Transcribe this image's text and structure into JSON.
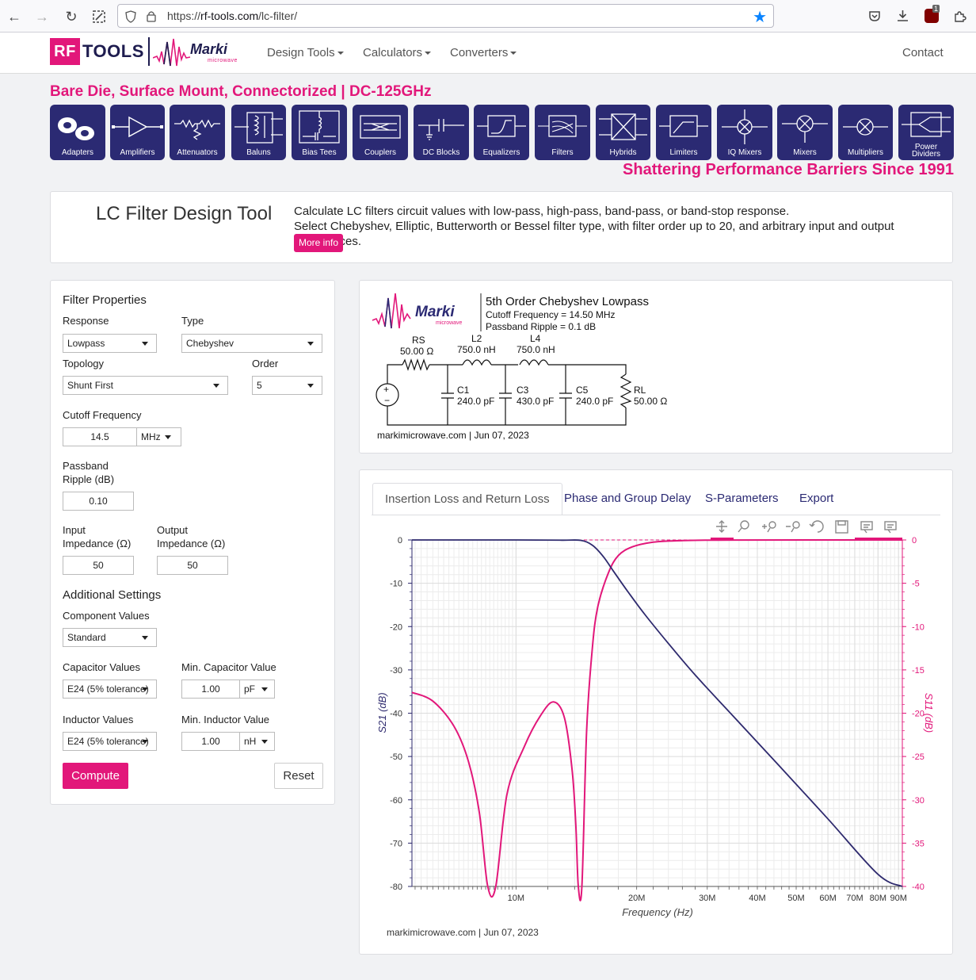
{
  "browser": {
    "url_prefix": "https://",
    "url_host": "rf-tools.com",
    "url_path": "/lc-filter/",
    "ext_badge": "1"
  },
  "header": {
    "logo_rf": "RF",
    "logo_tools": "TOOLS",
    "brand": "Marki",
    "brand_sub": "microwave",
    "menu": [
      "Design Tools",
      "Calculators",
      "Converters"
    ],
    "contact": "Contact"
  },
  "banner": {
    "title": "Bare Die, Surface Mount, Connectorized | DC-125GHz",
    "tagline": "Shattering Performance Barriers Since 1991",
    "products": [
      {
        "label": "Adapters",
        "icon": "adapter-icon"
      },
      {
        "label": "Amplifiers",
        "icon": "amplifier-icon"
      },
      {
        "label": "Attenuators",
        "icon": "attenuator-icon"
      },
      {
        "label": "Baluns",
        "icon": "balun-icon"
      },
      {
        "label": "Bias Tees",
        "icon": "bias-tee-icon"
      },
      {
        "label": "Couplers",
        "icon": "coupler-icon"
      },
      {
        "label": "DC Blocks",
        "icon": "dc-block-icon"
      },
      {
        "label": "Equalizers",
        "icon": "equalizer-icon"
      },
      {
        "label": "Filters",
        "icon": "filter-icon"
      },
      {
        "label": "Hybrids",
        "icon": "hybrid-icon"
      },
      {
        "label": "Limiters",
        "icon": "limiter-icon"
      },
      {
        "label": "IQ Mixers",
        "icon": "iq-mixer-icon"
      },
      {
        "label": "Mixers",
        "icon": "mixer-icon"
      },
      {
        "label": "Multipliers",
        "icon": "multiplier-icon"
      },
      {
        "label": "Power Dividers",
        "icon": "power-divider-icon"
      }
    ]
  },
  "intro": {
    "title": "LC Filter Design Tool",
    "line1": "Calculate LC filters circuit values with low-pass, high-pass, band-pass, or band-stop response.",
    "line2": "Select Chebyshev, Elliptic, Butterworth or Bessel filter type, with filter order up to 20, and arbitrary input and output impedances.",
    "more_info": "More info"
  },
  "form": {
    "section_filter": "Filter Properties",
    "response_label": "Response",
    "response_value": "Lowpass",
    "type_label": "Type",
    "type_value": "Chebyshev",
    "topology_label": "Topology",
    "topology_value": "Shunt First",
    "order_label": "Order",
    "order_value": "5",
    "cutoff_label": "Cutoff Frequency",
    "cutoff_value": "14.5",
    "cutoff_unit": "MHz",
    "ripple_label_1": "Passband",
    "ripple_label_2": "Ripple (dB)",
    "ripple_value": "0.10",
    "input_imp_label_1": "Input",
    "input_imp_label_2": "Impedance (Ω)",
    "input_imp_value": "50",
    "output_imp_label_1": "Output",
    "output_imp_label_2": "Impedance (Ω)",
    "output_imp_value": "50",
    "section_additional": "Additional Settings",
    "component_values_label": "Component Values",
    "component_values_value": "Standard",
    "cap_values_label": "Capacitor Values",
    "cap_values_value": "E24 (5% tolerance)",
    "min_cap_label": "Min. Capacitor Value",
    "min_cap_value": "1.00",
    "min_cap_unit": "pF",
    "ind_values_label": "Inductor Values",
    "ind_values_value": "E24 (5% tolerance)",
    "min_ind_label": "Min. Inductor Value",
    "min_ind_value": "1.00",
    "min_ind_unit": "nH",
    "compute": "Compute",
    "reset": "Reset"
  },
  "schematic": {
    "title": "5th Order Chebyshev Lowpass",
    "cutoff_line": "Cutoff Frequency = 14.50 MHz",
    "ripple_line": "Passband Ripple = 0.1 dB",
    "rs_name": "RS",
    "rs_value": "50.00 Ω",
    "l2_name": "L2",
    "l2_value": "750.0 nH",
    "l4_name": "L4",
    "l4_value": "750.0 nH",
    "c1_name": "C1",
    "c1_value": "240.0 pF",
    "c3_name": "C3",
    "c3_value": "430.0 pF",
    "c5_name": "C5",
    "c5_value": "240.0 pF",
    "rl_name": "RL",
    "rl_value": "50.00 Ω",
    "source_plus": "+",
    "source_minus": "−",
    "footer": "markimicrowave.com | Jun 07, 2023"
  },
  "tabs": [
    "Insertion Loss and Return Loss",
    "Phase and Group Delay",
    "S-Parameters",
    "Export"
  ],
  "toolbar_icons": [
    "pan-icon",
    "zoom-icon",
    "zoom-in-icon",
    "zoom-out-icon",
    "reset-icon",
    "save-icon",
    "hover-closest-icon",
    "hover-compare-icon"
  ],
  "chart_footer": "markimicrowave.com  |  Jun 07, 2023",
  "colors": {
    "brand_pink": "#e2177a",
    "brand_navy": "#2b2a73",
    "s21_line": "#2e2a6e",
    "s11_line": "#e2177a"
  },
  "chart_data": {
    "type": "line",
    "xlabel": "Frequency (Hz)",
    "ylabel": "S21 (dB)",
    "y2label": "S11 (dB)",
    "x_scale": "log",
    "xlim": [
      5500000,
      92000000
    ],
    "ylim": [
      -80,
      0
    ],
    "y2lim": [
      -40,
      0
    ],
    "x_ticks": [
      10000000,
      20000000,
      30000000,
      40000000,
      50000000,
      60000000,
      70000000,
      80000000,
      90000000
    ],
    "x_tick_labels": [
      "10M",
      "20M",
      "30M",
      "40M",
      "50M",
      "60M",
      "70M",
      "80M",
      "90M"
    ],
    "y_ticks": [
      0,
      -10,
      -20,
      -30,
      -40,
      -50,
      -60,
      -70,
      -80
    ],
    "y2_ticks": [
      0,
      -5,
      -10,
      -15,
      -20,
      -25,
      -30,
      -35,
      -40
    ],
    "grid": true,
    "series": [
      {
        "name": "S21 (dB)",
        "axis": "left",
        "x": [
          5500000,
          10000000,
          13000000,
          14500000,
          15500000,
          16500000,
          17500000,
          19000000,
          21000000,
          24000000,
          28000000,
          35000000,
          45000000,
          60000000,
          80000000,
          92000000
        ],
        "values": [
          0,
          0,
          -0.05,
          -0.1,
          -1.2,
          -3.8,
          -7.2,
          -11.9,
          -17.3,
          -23.9,
          -31.2,
          -40.9,
          -51.8,
          -64.4,
          -77.2,
          -80
        ]
      },
      {
        "name": "S11 (dB)",
        "axis": "right",
        "x": [
          5500000,
          6200000,
          7000000,
          7600000,
          8100000,
          8500000,
          8900000,
          9500000,
          10500000,
          11500000,
          12400000,
          13200000,
          13800000,
          14100000,
          14300000,
          14600000,
          15000000,
          15500000,
          16000000,
          17000000,
          18000000,
          19500000,
          22000000,
          26000000,
          35000000,
          92000000
        ],
        "values": [
          -17.6,
          -18.6,
          -21.5,
          -25.5,
          -31.5,
          -40,
          -40,
          -29.3,
          -23.8,
          -20.3,
          -18.7,
          -20.5,
          -26.5,
          -33,
          -40,
          -40,
          -22,
          -12.5,
          -7.7,
          -3.8,
          -1.8,
          -0.8,
          -0.25,
          -0.07,
          -0.01,
          0
        ]
      }
    ]
  }
}
